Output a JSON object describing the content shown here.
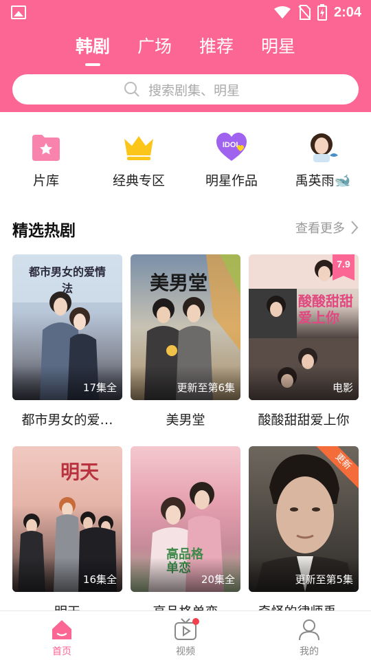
{
  "status_bar": {
    "time": "2:04"
  },
  "top_tabs": [
    {
      "label": "韩剧",
      "active": true
    },
    {
      "label": "广场",
      "active": false
    },
    {
      "label": "推荐",
      "active": false
    },
    {
      "label": "明星",
      "active": false
    }
  ],
  "search": {
    "placeholder": "搜索剧集、明星"
  },
  "categories": [
    {
      "label": "片库",
      "icon": "folder-star-icon"
    },
    {
      "label": "经典专区",
      "icon": "crown-icon"
    },
    {
      "label": "明星作品",
      "icon": "idol-heart-icon"
    },
    {
      "label": "禹英雨🐋",
      "icon": "avatar-whale-icon"
    }
  ],
  "section": {
    "title": "精选热剧",
    "more": "查看更多"
  },
  "cards": [
    {
      "title": "都市男女的爱…",
      "badge": "17集全",
      "poster_text": "都市男女的爱情法"
    },
    {
      "title": "美男堂",
      "badge": "更新至第6集",
      "poster_text": "美男堂"
    },
    {
      "title": "酸酸甜甜爱上你",
      "badge": "电影",
      "poster_text": "酸酸甜甜爱上你",
      "rating": "7.9"
    },
    {
      "title": "明天",
      "badge": "16集全",
      "poster_text": "明天"
    },
    {
      "title": "高品格单恋",
      "badge": "20集全",
      "poster_text": "高品格单恋"
    },
    {
      "title": "奇怪的律师禹…",
      "badge": "更新至第5集",
      "ribbon": "更新"
    }
  ],
  "bottom_nav": [
    {
      "label": "首页",
      "active": true
    },
    {
      "label": "视频",
      "active": false
    },
    {
      "label": "我的",
      "active": false
    }
  ],
  "colors": {
    "accent": "#fb6694"
  }
}
